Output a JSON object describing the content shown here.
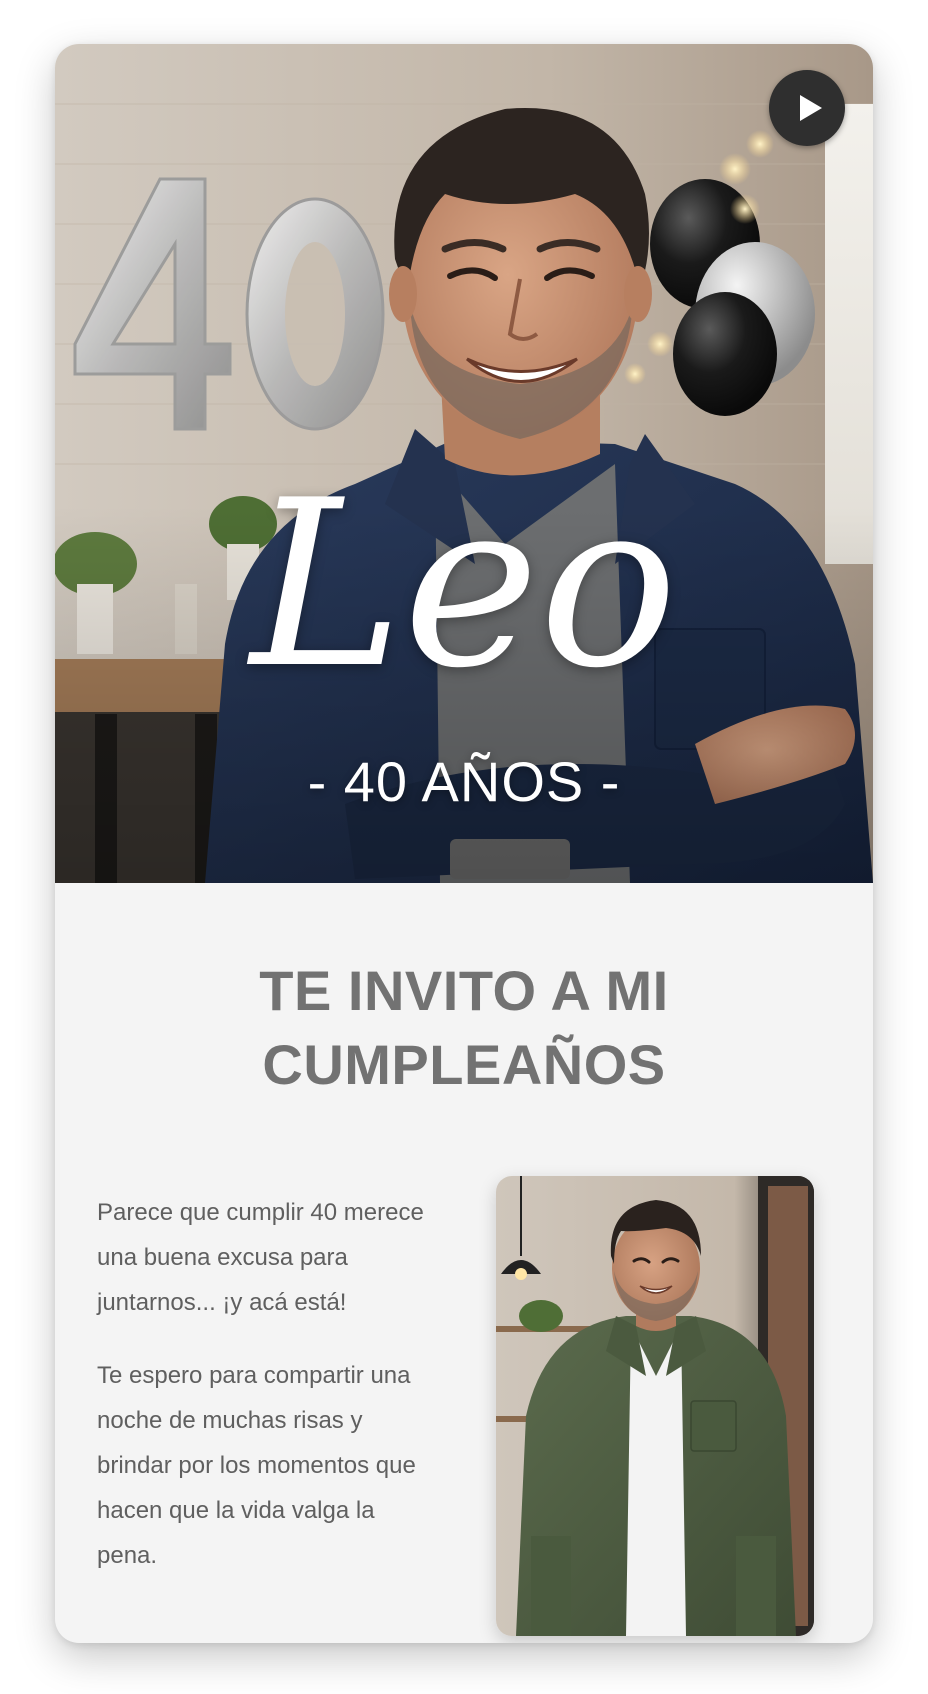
{
  "hero": {
    "name": "Leo",
    "age_line": "- 40 AÑOS -",
    "balloon_number": "40",
    "play_icon": "play-icon"
  },
  "invite": {
    "title_line1": "TE INVITO A MI",
    "title_line2": "CUMPLEAÑOS",
    "paragraph1": "Parece que cumplir 40 merece una buena excusa para juntarnos... ¡y acá está!",
    "paragraph2": "Te espero para compartir una noche de muchas risas y brindar por los momentos que hacen que la vida valga la pena."
  },
  "colors": {
    "card_bg": "#f4f4f4",
    "title_text": "#727272",
    "body_text": "#5f5f5f",
    "play_button": "#2f2f2f",
    "shirt_navy": "#1f2e4a",
    "shirt_olive": "#4f5f43"
  }
}
